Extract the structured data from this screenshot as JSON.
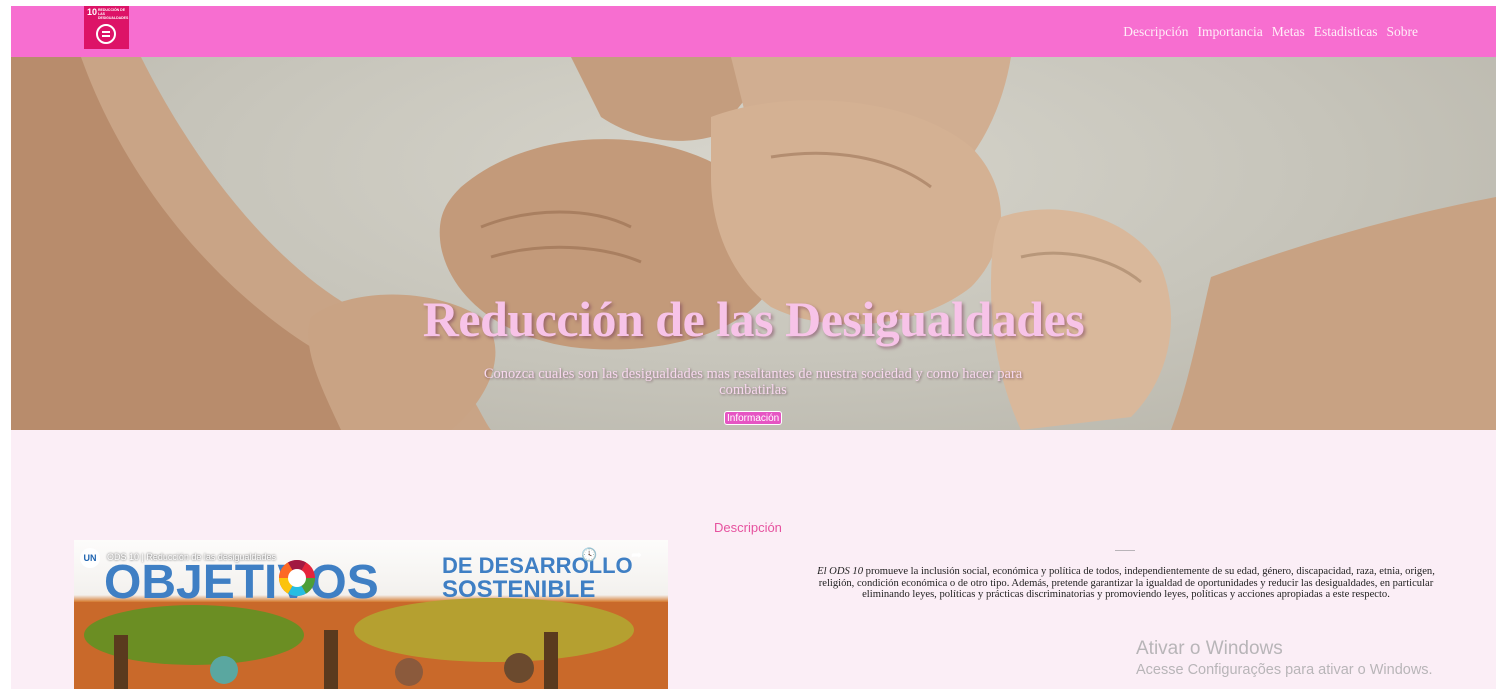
{
  "header": {
    "logo": {
      "number": "10",
      "text": "REDUCCIÓN DE LAS DESIGUALDADES",
      "icon": "equals-circle-icon",
      "color": "#dd1367"
    },
    "nav": [
      "Descripción",
      "Importancia",
      "Metas",
      "Estadisticas",
      "Sobre"
    ],
    "background": "#f76ed0"
  },
  "hero": {
    "title": "Reducción de las Desigualdades",
    "subtitle": "Conozca cuales son las desigualdades mas resaltantes de nuestra sociedad y como hacer para combatirlas",
    "button": "Información",
    "image": "linked-hands-photo"
  },
  "video": {
    "title": "ODS 10 | Reducción de las desigualdades",
    "channel_logo": "UN",
    "banner": {
      "word1": "OBJETIVOS",
      "word2": "DE DESARROLLO",
      "word3": "SOSTENIBLE"
    },
    "icons": [
      "watch-later-icon",
      "share-icon"
    ]
  },
  "description": {
    "heading": "Descripción",
    "lead": "El ODS 10",
    "text": " promueve la inclusión social, económica y política de todos, independientemente de su edad, género, discapacidad, raza, etnia, origen, religión, condición económica o de otro tipo. Además, pretende garantizar la igualdad de oportunidades y reducir las desigualdades, en particular eliminando leyes, políticas y prácticas discriminatorias y promoviendo leyes, políticas y acciones apropiadas a este respecto."
  },
  "watermark": {
    "title": "Ativar o Windows",
    "subtitle": "Acesse Configurações para ativar o Windows."
  },
  "colors": {
    "accent": "#f76ed0",
    "page_bg": "#fbeef6",
    "heading": "#e6529f"
  }
}
